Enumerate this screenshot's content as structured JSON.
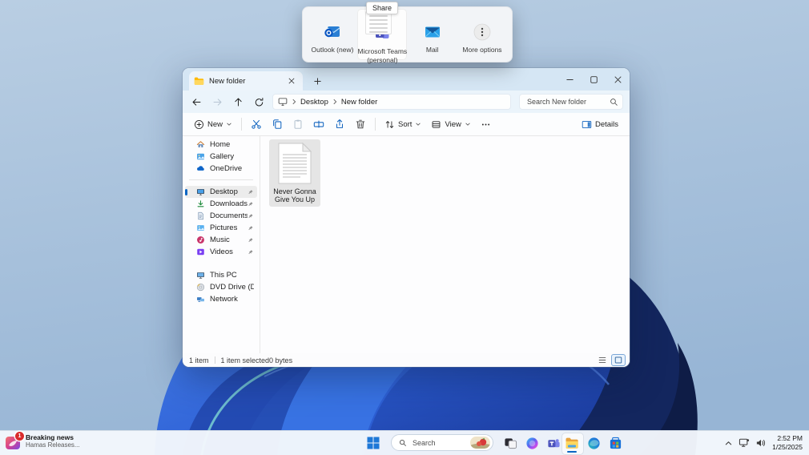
{
  "colors": {
    "accent": "#0b66c3",
    "folder_yellow": "#ffc634",
    "teams_purple": "#4b53bc",
    "wallpaper_blue": "#2d5fd4",
    "wallpaper_navy": "#13265e"
  },
  "share_flyout": {
    "tooltip": "Share",
    "items": [
      {
        "label": "Outlook (new)",
        "icon": "outlook-icon"
      },
      {
        "label": "Microsoft Teams (personal)",
        "icon": "teams-icon",
        "hovered": true
      },
      {
        "label": "Mail",
        "icon": "mail-icon"
      },
      {
        "label": "More options",
        "icon": "more-options-icon"
      }
    ]
  },
  "explorer": {
    "tab_title": "New folder",
    "breadcrumbs": [
      "Desktop",
      "New folder"
    ],
    "search_placeholder": "Search New folder",
    "toolbar": {
      "new": "New",
      "sort": "Sort",
      "view": "View",
      "details": "Details"
    },
    "sidebar": {
      "top": [
        {
          "label": "Home",
          "icon": "home-icon"
        },
        {
          "label": "Gallery",
          "icon": "gallery-icon"
        },
        {
          "label": "OneDrive",
          "icon": "onedrive-icon"
        }
      ],
      "pinned": [
        {
          "label": "Desktop",
          "icon": "desktop-icon",
          "selected": true
        },
        {
          "label": "Downloads",
          "icon": "downloads-icon"
        },
        {
          "label": "Documents",
          "icon": "documents-icon"
        },
        {
          "label": "Pictures",
          "icon": "pictures-icon"
        },
        {
          "label": "Music",
          "icon": "music-icon"
        },
        {
          "label": "Videos",
          "icon": "videos-icon"
        }
      ],
      "devices": [
        {
          "label": "This PC",
          "icon": "this-pc-icon"
        },
        {
          "label": "DVD Drive (D:) CCCC",
          "icon": "dvd-icon"
        },
        {
          "label": "Network",
          "icon": "network-icon"
        }
      ]
    },
    "files": [
      {
        "name": "Never Gonna Give You Up",
        "type": "document",
        "selected": true
      }
    ],
    "statusbar": {
      "count": "1 item",
      "selected": "1 item selected",
      "size": "0 bytes"
    }
  },
  "taskbar": {
    "widget": {
      "title": "Breaking news",
      "subtitle": "Hamas Releases...",
      "badge": "1"
    },
    "search_placeholder": "Search",
    "apps": [
      "Start",
      "Task View",
      "Copilot",
      "Microsoft Teams",
      "File Explorer",
      "Microsoft Edge",
      "Microsoft Store"
    ],
    "tray": {
      "time": "2:52 PM",
      "date": "1/25/2025"
    }
  }
}
